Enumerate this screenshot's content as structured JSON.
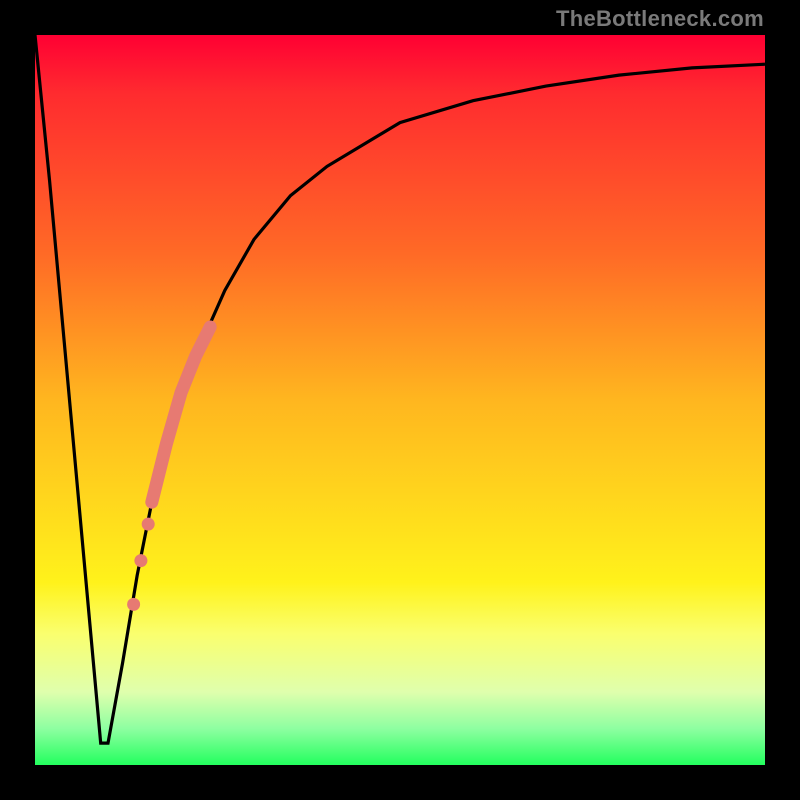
{
  "attribution": "TheBottleneck.com",
  "chart_data": {
    "type": "line",
    "title": "",
    "xlabel": "",
    "ylabel": "",
    "xlim": [
      0,
      100
    ],
    "ylim": [
      0,
      100
    ],
    "background_gradient": {
      "top": "#ff0033",
      "mid_upper": "#ff6a26",
      "mid": "#fff21b",
      "bottom": "#23ff5e"
    },
    "series": [
      {
        "name": "bottleneck-curve",
        "color": "#000000",
        "x": [
          0,
          2,
          4,
          6,
          8,
          9,
          10,
          12,
          14,
          16,
          18,
          20,
          22,
          26,
          30,
          35,
          40,
          50,
          60,
          70,
          80,
          90,
          100
        ],
        "y": [
          100,
          80,
          58,
          36,
          14,
          3,
          3,
          14,
          26,
          36,
          44,
          51,
          56,
          65,
          72,
          78,
          82,
          88,
          91,
          93,
          94.5,
          95.5,
          96
        ]
      },
      {
        "name": "highlight-segment",
        "color": "#e77a72",
        "style": "thick",
        "x": [
          16,
          24
        ],
        "y": [
          36,
          60
        ]
      },
      {
        "name": "highlight-dots",
        "color": "#e77a72",
        "style": "dots",
        "points": [
          {
            "x": 15.5,
            "y": 33
          },
          {
            "x": 14.5,
            "y": 28
          },
          {
            "x": 13.5,
            "y": 22
          }
        ]
      }
    ]
  }
}
